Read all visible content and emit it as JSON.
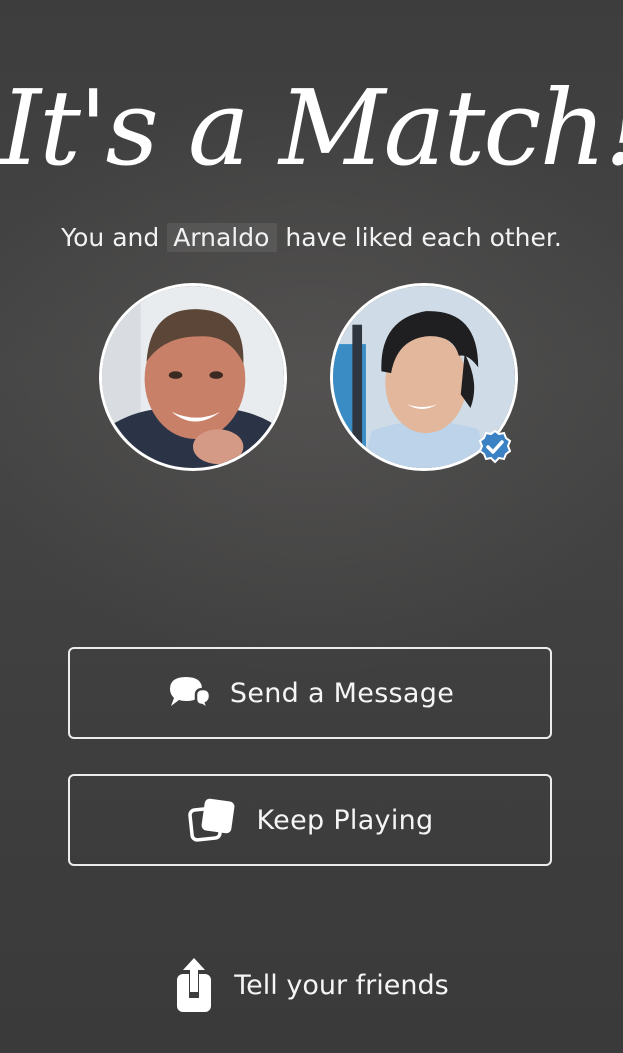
{
  "title": "It's a Match!",
  "subtitle": {
    "prefix": "You and",
    "name": "Arnaldo",
    "suffix": "have liked each other."
  },
  "avatars": {
    "left": {
      "alt": "avatar"
    },
    "right": {
      "alt": "avatar",
      "verified": true
    }
  },
  "buttons": {
    "send_message": "Send a Message",
    "keep_playing": "Keep Playing"
  },
  "share": {
    "label": "Tell your friends"
  },
  "colors": {
    "background": "#3d3d3d",
    "text": "#ffffff",
    "verified_badge": "#3b82c4"
  },
  "icons": {
    "message": "chat-bubbles-icon",
    "keep_playing": "stacked-cards-icon",
    "share": "share-upload-icon",
    "verified": "verified-badge-icon"
  }
}
